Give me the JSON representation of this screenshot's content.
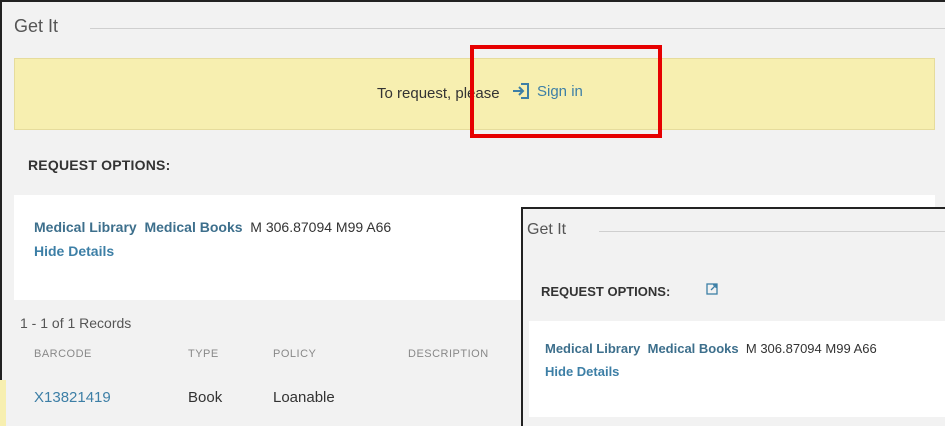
{
  "main": {
    "title": "Get It",
    "signin_prompt": "To request, please",
    "signin_label": "Sign in",
    "request_options": "REQUEST OPTIONS:",
    "location": {
      "library": "Medical Library",
      "collection": "Medical Books",
      "call_number": "M 306.87094 M99 A66"
    },
    "hide_details": "Hide Details",
    "records": "1 - 1 of 1 Records",
    "table": {
      "headers": [
        "BARCODE",
        "TYPE",
        "POLICY",
        "DESCRIPTION"
      ],
      "rows": [
        {
          "barcode": "X13821419",
          "type": "Book",
          "policy": "Loanable"
        }
      ]
    }
  },
  "inset": {
    "title": "Get It",
    "request_options": "REQUEST OPTIONS:",
    "location": {
      "library": "Medical Library",
      "collection": "Medical Books",
      "call_number": "M 306.87094 M99 A66"
    },
    "hide_details": "Hide Details"
  },
  "colors": {
    "highlight": "#e60000",
    "banner": "#f7efb0",
    "link": "#3d7fa6"
  },
  "icons": {
    "signin": "sign-in-icon",
    "external": "external-link-icon"
  }
}
